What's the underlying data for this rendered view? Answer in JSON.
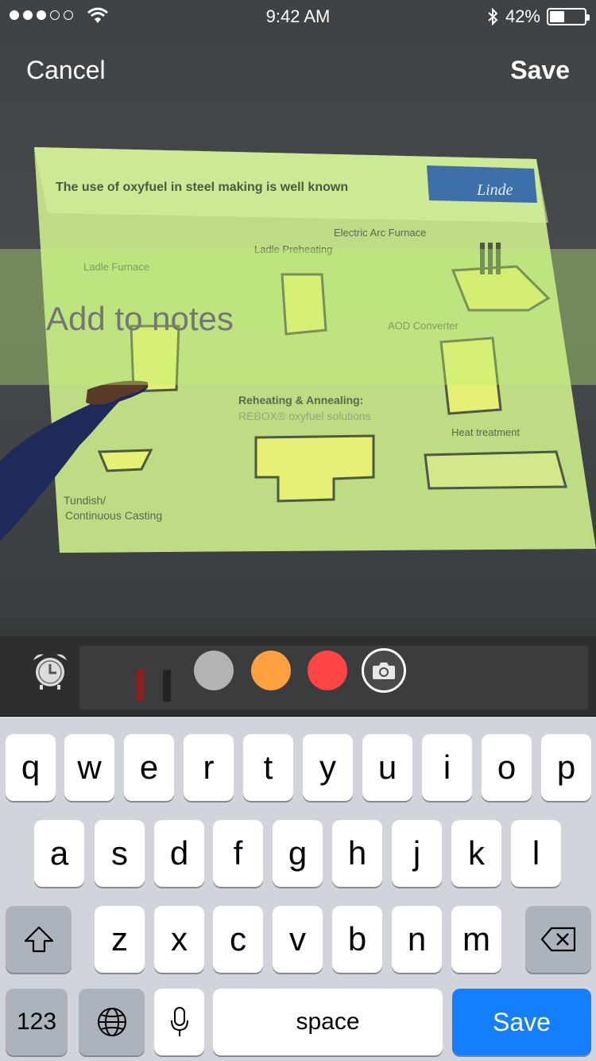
{
  "status_bar": {
    "signal_dots_filled": 3,
    "signal_dots_total": 5,
    "time": "9:42 AM",
    "battery_percent": "42%",
    "battery_level": 0.42
  },
  "nav": {
    "cancel_label": "Cancel",
    "save_label": "Save"
  },
  "notes": {
    "placeholder": "Add to notes"
  },
  "photo_slide": {
    "title": "The use of oxyfuel in steel making is well known",
    "logo_text": "Linde",
    "labels": {
      "electric_arc": "Electric Arc Furnace",
      "ladle_preheating": "Ladle Preheating",
      "ladle_furnace": "Ladle Furnace",
      "aod": "AOD Converter",
      "reheating": "Reheating & Annealing:",
      "rebox": "REBOX® oxyfuel solutions",
      "heat_treatment": "Heat treatment",
      "tundish": "Tundish/",
      "continuous": "Continuous Casting"
    }
  },
  "toolbar": {
    "alarm_icon": "alarm-clock-icon",
    "colors": {
      "gray": "#b3b3b3",
      "orange": "#ffa040",
      "red": "#ff4444"
    },
    "camera_icon": "camera-icon"
  },
  "keyboard": {
    "row1": [
      "q",
      "w",
      "e",
      "r",
      "t",
      "y",
      "u",
      "i",
      "o",
      "p"
    ],
    "row2": [
      "a",
      "s",
      "d",
      "f",
      "g",
      "h",
      "j",
      "k",
      "l"
    ],
    "row3": [
      "z",
      "x",
      "c",
      "v",
      "b",
      "n",
      "m"
    ],
    "numbers_label": "123",
    "space_label": "space",
    "return_label": "Save"
  }
}
